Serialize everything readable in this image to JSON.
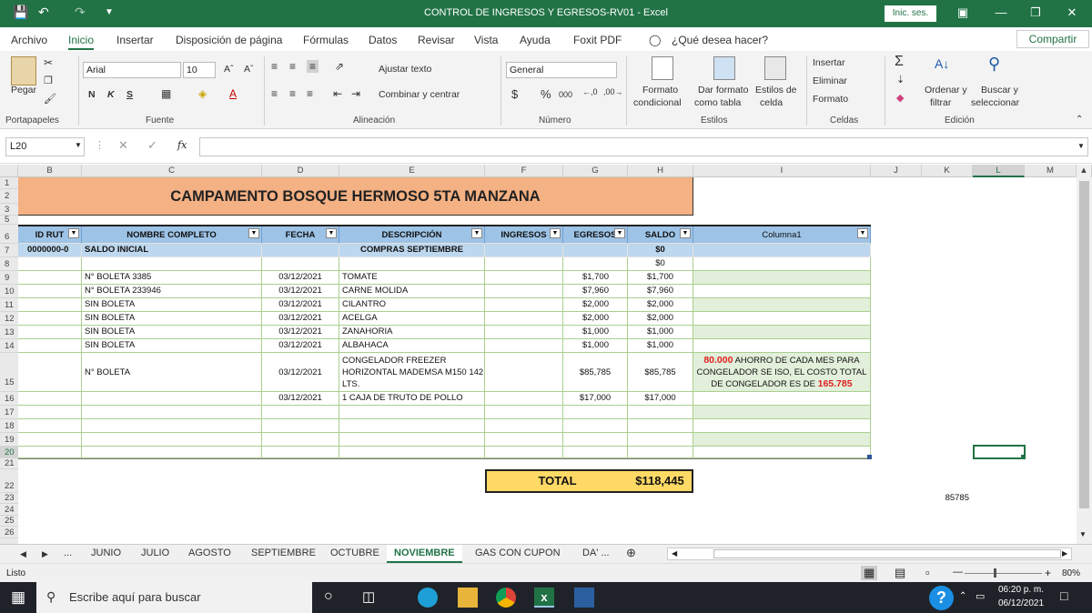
{
  "window": {
    "title": "CONTROL DE INGRESOS Y EGRESOS-RV01  -  Excel",
    "login": "Inic. ses."
  },
  "ribbon_tabs": [
    "Archivo",
    "Inicio",
    "Insertar",
    "Disposición de página",
    "Fórmulas",
    "Datos",
    "Revisar",
    "Vista",
    "Ayuda",
    "Foxit PDF"
  ],
  "tell_me": "¿Qué desea hacer?",
  "share": "Compartir",
  "ribbon": {
    "clipboard": {
      "paste": "Pegar",
      "group": "Portapapeles"
    },
    "font": {
      "name": "Arial",
      "size": "10",
      "bold": "N",
      "italic": "K",
      "underline": "S",
      "group": "Fuente"
    },
    "alignment": {
      "wrap": "Ajustar texto",
      "merge": "Combinar y centrar",
      "group": "Alineación"
    },
    "number": {
      "format": "General",
      "currency": "$",
      "percent": "%",
      "thousands": "000",
      "group": "Número"
    },
    "styles": {
      "cond1": "Formato",
      "cond2": "condicional",
      "tbl1": "Dar formato",
      "tbl2": "como tabla",
      "cell1": "Estilos de",
      "cell2": "celda",
      "group": "Estilos"
    },
    "cells": {
      "insert": "Insertar",
      "delete": "Eliminar",
      "format": "Formato",
      "group": "Celdas"
    },
    "editing": {
      "sort1": "Ordenar y",
      "sort2": "filtrar",
      "find1": "Buscar y",
      "find2": "seleccionar",
      "group": "Edición"
    }
  },
  "formula_bar": {
    "namebox": "L20",
    "fx": "fx",
    "formula": ""
  },
  "columns": [
    "B",
    "C",
    "D",
    "E",
    "F",
    "G",
    "H",
    "I",
    "J",
    "K",
    "L",
    "M"
  ],
  "rows": [
    "1",
    "2",
    "3",
    "5",
    "6",
    "7",
    "8",
    "9",
    "10",
    "11",
    "12",
    "13",
    "14",
    "15",
    "16",
    "17",
    "18",
    "19",
    "20",
    "21",
    "22",
    "23",
    "24",
    "25",
    "26"
  ],
  "sheet": {
    "banner": "CAMPAMENTO BOSQUE HERMOSO 5TA MANZANA",
    "headers": [
      "ID RUT",
      "NOMBRE COMPLETO",
      "FECHA",
      "DESCRIPCIÓN",
      "INGRESOS",
      "EGRESOS",
      "SALDO",
      "Columna1"
    ],
    "row7": {
      "id": "0000000-0",
      "name": "SALDO INICIAL",
      "desc": "COMPRAS SEPTIEMBRE",
      "saldo": "$0"
    },
    "row8": {
      "saldo": "$0"
    },
    "data": [
      {
        "name": "N° BOLETA 3385",
        "fecha": "03/12/2021",
        "desc": "TOMATE",
        "egresos": "$1,700",
        "saldo": "$1,700"
      },
      {
        "name": "N° BOLETA 233946",
        "fecha": "03/12/2021",
        "desc": "CARNE MOLIDA",
        "egresos": "$7,960",
        "saldo": "$7,960"
      },
      {
        "name": "SIN BOLETA",
        "fecha": "03/12/2021",
        "desc": "CILANTRO",
        "egresos": "$2,000",
        "saldo": "$2,000"
      },
      {
        "name": "SIN BOLETA",
        "fecha": "03/12/2021",
        "desc": "ACELGA",
        "egresos": "$2,000",
        "saldo": "$2,000"
      },
      {
        "name": "SIN BOLETA",
        "fecha": "03/12/2021",
        "desc": "ZANAHORIA",
        "egresos": "$1,000",
        "saldo": "$1,000"
      },
      {
        "name": "SIN BOLETA",
        "fecha": "03/12/2021",
        "desc": "ALBAHACA",
        "egresos": "$1,000",
        "saldo": "$1,000"
      }
    ],
    "row15": {
      "name": "N° BOLETA",
      "fecha": "03/12/2021",
      "desc1": "CONGELADOR FREEZER",
      "desc2": "HORIZONTAL MADEMSA M150 142",
      "desc3": "LTS.",
      "egresos": "$85,785",
      "saldo": "$85,785",
      "note_amount": "80.000",
      "note_a": " AHORRO DE CADA MES PARA",
      "note_b": "CONGELADOR SE ISO, EL COSTO TOTAL",
      "note_c": "DE CONGELADOR ES DE ",
      "note_total": "165.785"
    },
    "row16": {
      "fecha": "03/12/2021",
      "desc": "1 CAJA DE TRUTO DE POLLO",
      "egresos": "$17,000",
      "saldo": "$17,000"
    },
    "total_label": "TOTAL",
    "total_value": "$118,445",
    "k23": "85785"
  },
  "sheet_tabs": [
    "...",
    "JUNIO",
    "JULIO",
    "AGOSTO",
    "SEPTIEMBRE",
    "OCTUBRE",
    "NOVIEMBRE",
    "GAS CON CUPON",
    "DA' ..."
  ],
  "status": {
    "ready": "Listo",
    "zoom": "80%"
  },
  "taskbar": {
    "search": "Escribe aquí para buscar",
    "time": "06:20 p. m.",
    "date": "06/12/2021"
  },
  "colors": {
    "excel_green": "#217346",
    "banner": "#f4b183",
    "header_blue": "#9dc3e6",
    "light_blue": "#bdd7ee",
    "total_yellow": "#ffd966",
    "note_red": "#e02020",
    "note_green": "#e2efda"
  }
}
